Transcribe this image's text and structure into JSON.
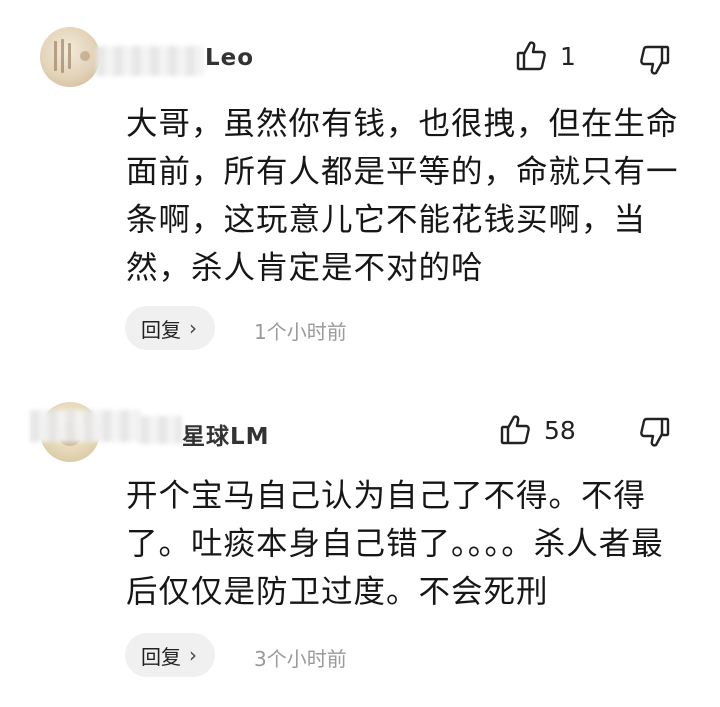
{
  "comments": [
    {
      "username": "Leo",
      "likes": "1",
      "text": "大哥，虽然你有钱，也很拽，但在生命面前，所有人都是平等的，命就只有一条啊，这玩意儿它不能花钱买啊，当然，杀人肯定是不对的哈",
      "reply_label": "回复",
      "time": "1个小时前"
    },
    {
      "username": "星球LM",
      "likes": "58",
      "text": "开个宝马自己认为自己了不得。不得了。吐痰本身自己错了。。。。杀人者最后仅仅是防卫过度。不会死刑",
      "reply_label": "回复",
      "time": "3个小时前"
    }
  ],
  "icons": {
    "like": "thumb-up-icon",
    "dislike": "thumb-down-icon",
    "reply_arrow": "chevron-right-icon"
  }
}
